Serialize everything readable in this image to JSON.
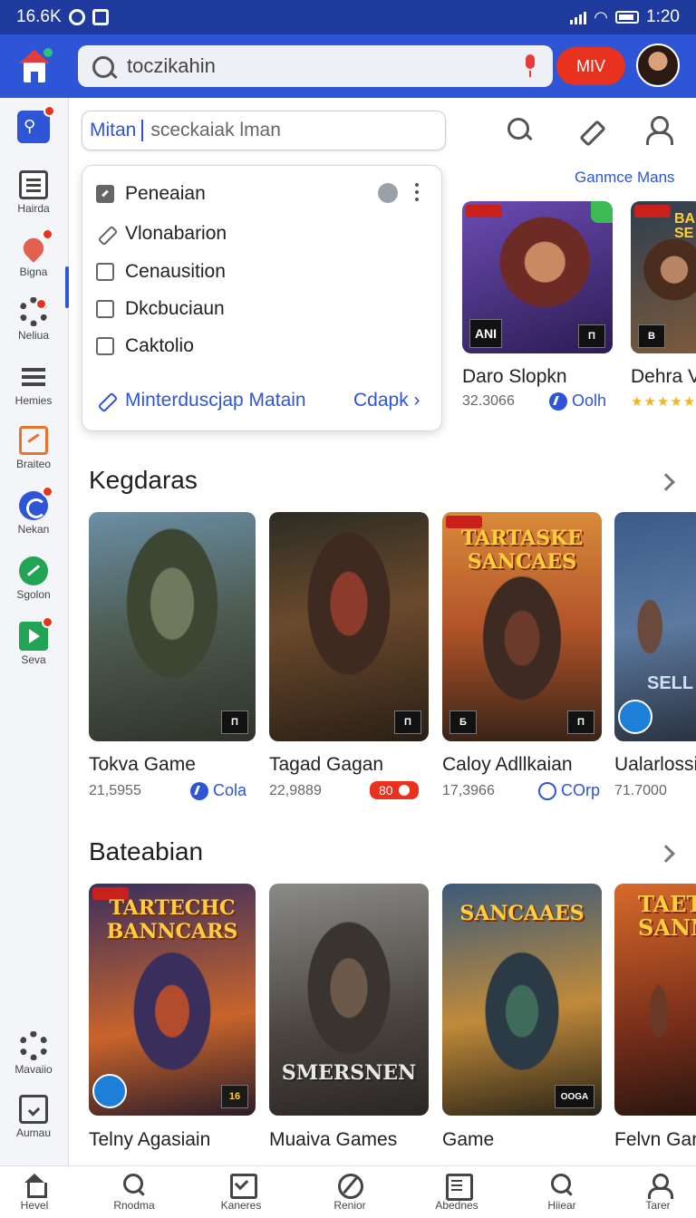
{
  "status_bar": {
    "left_text": "16.6K",
    "time": "1:20"
  },
  "header": {
    "search_query": "toczikahin",
    "action_button": "MIV"
  },
  "sidebar": {
    "items": [
      {
        "label": "",
        "icon": "link-icon"
      },
      {
        "label": "Hairda",
        "icon": "document-icon"
      },
      {
        "label": "Bigna",
        "icon": "pin-icon"
      },
      {
        "label": "Neliua",
        "icon": "gear-icon"
      },
      {
        "label": "Hemies",
        "icon": "list-icon"
      },
      {
        "label": "Braiteo",
        "icon": "edit-icon"
      },
      {
        "label": "Nekan",
        "icon": "refresh-icon"
      },
      {
        "label": "Sgolon",
        "icon": "trend-icon"
      },
      {
        "label": "Seva",
        "icon": "play-icon"
      },
      {
        "label": "Mavaiio",
        "icon": "settings-icon"
      },
      {
        "label": "Aumau",
        "icon": "checkbox-icon"
      }
    ]
  },
  "filter": {
    "selected": "Mitan",
    "rest": "sceckaiak lman"
  },
  "dropdown": {
    "options": [
      {
        "label": "Peneaian",
        "checked": true
      },
      {
        "label": "Vlonabarion",
        "checked": false
      },
      {
        "label": "Cenausition",
        "checked": false
      },
      {
        "label": "Dkcbuciaun",
        "checked": false
      },
      {
        "label": "Caktolio",
        "checked": false
      }
    ],
    "footer_link": "Minterduscjap Matain",
    "footer_more": "Cdapk"
  },
  "featured": {
    "link": "Ganmce Mans",
    "cards": [
      {
        "title": "Daro Slopkn",
        "meta": "32.3066",
        "tag": "Oolh",
        "logo": "ANI"
      },
      {
        "title": "Dehra V",
        "rating": "★★★★★",
        "art_text": "BA SE"
      }
    ]
  },
  "sections": [
    {
      "title": "Kegdaras",
      "cards": [
        {
          "title": "Tokva Game",
          "meta": "21,5955",
          "tag": "Cola"
        },
        {
          "title": "Tagad Gagan",
          "meta": "22,9889",
          "pill": "80"
        },
        {
          "title": "Caloy Adllkaian",
          "meta": "17,3966",
          "tag": "COrp",
          "art_text": "TARTASKE SANCAES"
        },
        {
          "title": "Ualarlossi",
          "meta": "71.7000",
          "art_text": "SELL"
        }
      ]
    },
    {
      "title": "Bateabian",
      "cards": [
        {
          "title": "Telny Agasiain",
          "art_text": "TARTECHC BANNCARS"
        },
        {
          "title": "Muaiva Games",
          "art_text": "SMERSNEN"
        },
        {
          "title": "Game",
          "art_text": "SANCAAES",
          "logo": "OOGA"
        },
        {
          "title": "Felvn Gan",
          "art_text": "TAET SANN"
        }
      ]
    }
  ],
  "bottom_nav": [
    {
      "label": "Hevel",
      "icon": "home-icon"
    },
    {
      "label": "Rnodma",
      "icon": "search-icon"
    },
    {
      "label": "Kaneres",
      "icon": "check-icon"
    },
    {
      "label": "Renior",
      "icon": "slash-icon"
    },
    {
      "label": "Abednes",
      "icon": "list-icon"
    },
    {
      "label": "Hiiear",
      "icon": "search-icon"
    },
    {
      "label": "Tarer",
      "icon": "user-icon"
    }
  ],
  "colors": {
    "primary": "#2d55d6",
    "status_bar": "#1e3a9e",
    "accent_red": "#e8321e",
    "star": "#f3b51e"
  }
}
